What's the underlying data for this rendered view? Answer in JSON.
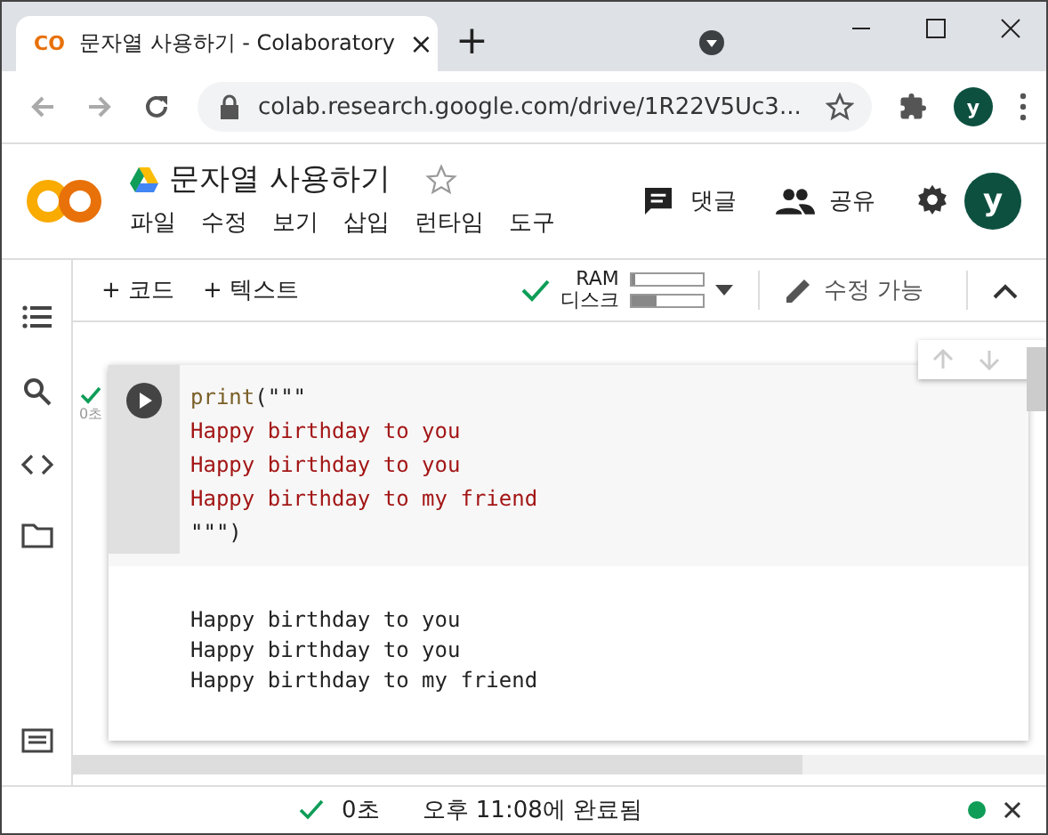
{
  "browser": {
    "tab_title": "문자열 사용하기 - Colaboratory",
    "tab_close": "×",
    "new_tab": "+",
    "url": "colab.research.google.com/drive/1R22V5Uc3...",
    "profile": "y"
  },
  "header": {
    "logo": "CO",
    "title": "문자열 사용하기",
    "starred": false,
    "menu": [
      "파일",
      "수정",
      "보기",
      "삽입",
      "런타임",
      "도구"
    ],
    "comment": "댓글",
    "share": "공유",
    "avatar": "y"
  },
  "toolbar": {
    "add_code": "+ 코드",
    "add_text": "+ 텍스트",
    "ram_label": "RAM",
    "disk_label": "디스크",
    "ram": {
      "level": 0.05
    },
    "disk": {
      "level": 0.35
    },
    "edit_mode": "수정 가능"
  },
  "cell": {
    "run_time": "0초",
    "code": [
      [
        {
          "text": "print",
          "kind": "func"
        },
        {
          "text": "(\"\"\"",
          "kind": "plain"
        }
      ],
      [
        {
          "text": "Happy birthday to you",
          "kind": "string"
        }
      ],
      [
        {
          "text": "Happy birthday to you",
          "kind": "string"
        }
      ],
      [
        {
          "text": "Happy birthday to my friend",
          "kind": "string"
        }
      ],
      [
        {
          "text": "\"\"\")",
          "kind": "plain"
        }
      ]
    ],
    "output": [
      "Happy birthday to you",
      "Happy birthday to you",
      "Happy birthday to my friend"
    ]
  },
  "status_bar": {
    "elapsed": "0초",
    "completed": "오후 11:08에 완료됨",
    "connected": true
  }
}
